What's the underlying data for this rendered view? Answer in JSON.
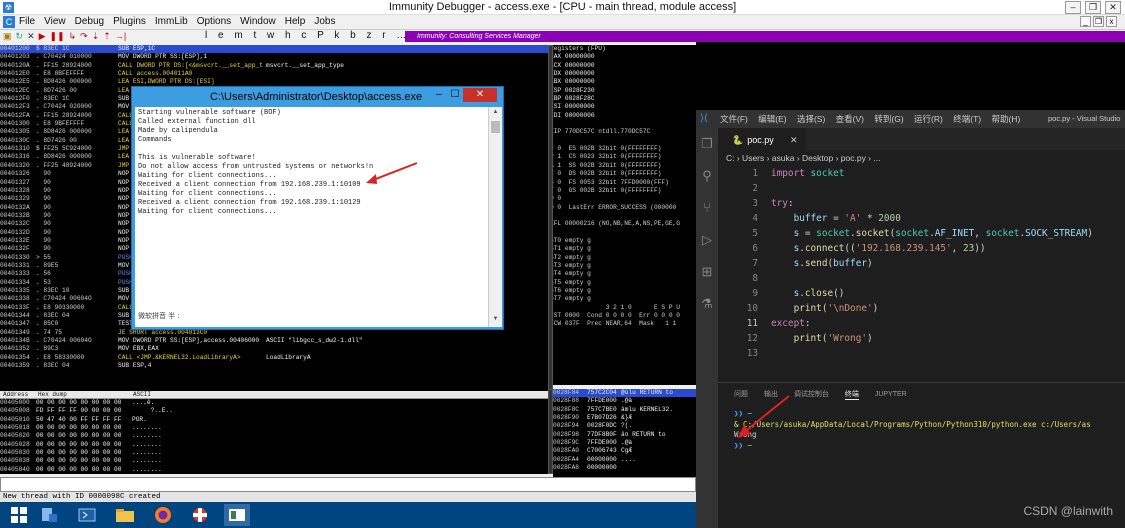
{
  "window": {
    "title": "Immunity Debugger - access.exe - [CPU - main thread, module access]"
  },
  "menu": [
    "File",
    "View",
    "Debug",
    "Plugins",
    "ImmLib",
    "Options",
    "Window",
    "Help",
    "Jobs"
  ],
  "toolbar": {
    "letters": "l e m t w h c P k b z r … s ?",
    "banner": "Immunity: Consulting Services Manager"
  },
  "cpu_rows": [
    {
      "addr": "00401200",
      "hex": "$ 83EC 1C",
      "asm": "SUB ESP,1C",
      "cmt": "",
      "sel": true
    },
    {
      "addr": "00401203",
      "hex": ". C70424 010000",
      "asm": "MOV DWORD PTR SS:[ESP],1",
      "cmt": ""
    },
    {
      "addr": "0040120A",
      "hex": ". FF15 28924000",
      "asm": "CALL DWORD PTR DS:[<&msvcrt.__set_app_t",
      "cmt": "msvcrt.__set_app_type"
    },
    {
      "addr": "004012E0",
      "hex": ". E8 0BFEFFFF",
      "asm": "CALL access.004011A0",
      "cmt": ""
    },
    {
      "addr": "004012E5",
      "hex": ". 8D8426 000000",
      "asm": "LEA ESI,DWORD PTR DS:[ESI]",
      "cmt": ""
    },
    {
      "addr": "004012EC",
      "hex": ". 8D7426 00",
      "asm": "LEA ESI,",
      "cmt": ""
    },
    {
      "addr": "004012F0",
      "hex": ". 83EC 1C",
      "asm": "SUB ESP",
      "cmt": ""
    },
    {
      "addr": "004012F3",
      "hex": ". C70424 020000",
      "asm": "MOV DWO",
      "cmt": ""
    },
    {
      "addr": "004012FA",
      "hex": ". FF15 28924000",
      "asm": "CALL DW",
      "cmt": ""
    },
    {
      "addr": "00401300",
      "hex": ". E8 9BFEFFFF",
      "asm": "CALL ac",
      "cmt": ""
    },
    {
      "addr": "00401305",
      "hex": ". 8D8426 000000",
      "asm": "LEA ESI",
      "cmt": ""
    },
    {
      "addr": "0040130C",
      "hex": ". 8D7426 00",
      "asm": "LEA ESI",
      "cmt": ""
    },
    {
      "addr": "00401310",
      "hex": "$ FF25 5C924000",
      "asm": "JMP DWO",
      "cmt": ""
    },
    {
      "addr": "00401316",
      "hex": ". 8D8426 000000",
      "asm": "LEA ESI",
      "cmt": ""
    },
    {
      "addr": "00401320",
      "hex": ". FF25 48924000",
      "asm": "JMP DWO",
      "cmt": ""
    },
    {
      "addr": "00401326",
      "hex": "  90",
      "asm": "NOP",
      "cmt": ""
    },
    {
      "addr": "00401327",
      "hex": "  90",
      "asm": "NOP",
      "cmt": ""
    },
    {
      "addr": "00401328",
      "hex": "  90",
      "asm": "NOP",
      "cmt": ""
    },
    {
      "addr": "00401329",
      "hex": "  90",
      "asm": "NOP",
      "cmt": ""
    },
    {
      "addr": "0040132A",
      "hex": "  90",
      "asm": "NOP",
      "cmt": ""
    },
    {
      "addr": "0040132B",
      "hex": "  90",
      "asm": "NOP",
      "cmt": ""
    },
    {
      "addr": "0040132C",
      "hex": "  90",
      "asm": "NOP",
      "cmt": ""
    },
    {
      "addr": "0040132D",
      "hex": "  90",
      "asm": "NOP",
      "cmt": ""
    },
    {
      "addr": "0040132E",
      "hex": "  90",
      "asm": "NOP",
      "cmt": ""
    },
    {
      "addr": "0040132F",
      "hex": "  90",
      "asm": "NOP",
      "cmt": ""
    },
    {
      "addr": "00401330",
      "hex": "> 55",
      "asm": "PUSH EB",
      "cmt": ""
    },
    {
      "addr": "00401331",
      "hex": ". 89E5",
      "asm": "MOV EBP",
      "cmt": ""
    },
    {
      "addr": "00401333",
      "hex": ". 56",
      "asm": "PUSH ES",
      "cmt": ""
    },
    {
      "addr": "00401334",
      "hex": ". 53",
      "asm": "PUSH EB",
      "cmt": ""
    },
    {
      "addr": "00401335",
      "hex": ". 83EC 10",
      "asm": "SUB ESP",
      "cmt": ""
    },
    {
      "addr": "00401338",
      "hex": ". C70424 00604O",
      "asm": "MOV DWO",
      "cmt": ""
    },
    {
      "addr": "0040133F",
      "hex": ". E8 90330000",
      "asm": "CALL <J",
      "cmt": ""
    },
    {
      "addr": "00401344",
      "hex": ". 83EC 04",
      "asm": "SUB ESP",
      "cmt": ""
    },
    {
      "addr": "00401347",
      "hex": ". 85C0",
      "asm": "TEST EAX,EAX",
      "cmt": ""
    },
    {
      "addr": "00401349",
      "hex": ". 74 75",
      "asm": "JE SHORT access.004013C0",
      "cmt": ""
    },
    {
      "addr": "0040134B",
      "hex": ". C70424 00604O",
      "asm": "MOV DWORD PTR SS:[ESP],access.00406000",
      "cmt": "ASCII \"libgcc_s_dw2-1.dll\""
    },
    {
      "addr": "00401352",
      "hex": ". 89C3",
      "asm": "MOV EBX,EAX",
      "cmt": ""
    },
    {
      "addr": "00401354",
      "hex": ". E8 58330000",
      "asm": "CALL <JMP.&KERNEL32.LoadLibraryA>",
      "cmt": "LoadLibraryA"
    },
    {
      "addr": "00401359",
      "hex": ". 83EC 04",
      "asm": "SUB ESP,4",
      "cmt": ""
    }
  ],
  "registers": {
    "header": "Registers (FPU)",
    "lines": [
      "EAX 00000000",
      "ECX 00000000",
      "EDX 00000000",
      "EBX 00000000",
      "ESP 0028F230",
      "EBP 0028F28C",
      "ESI 00000000",
      "EDI 00000000",
      "",
      "EIP 770DC57C ntdll.770DC57C",
      "",
      "C 0  ES 002B 32bit 0(FFFFFFFF)",
      "P 1  CS 0023 32bit 0(FFFFFFFF)",
      "A 1  SS 002B 32bit 0(FFFFFFFF)",
      "Z 0  DS 002B 32bit 0(FFFFFFFF)",
      "S 0  FS 0053 32bit 7FFD0000(FFF)",
      "T 0  GS 002B 32bit 0(FFFFFFFF)",
      "D 0",
      "O 0  LastErr ERROR_SUCCESS (000000",
      "",
      "EFL 00000216 (NO,NB,NE,A,NS,PE,GE,G",
      "",
      "ST0 empty g",
      "ST1 empty g",
      "ST2 empty g",
      "ST3 empty g",
      "ST4 empty g",
      "ST5 empty g",
      "ST6 empty g",
      "ST7 empty g",
      "               3 2 1 0      E S P U",
      "FST 0000  Cond 0 0 0 0  Err 0 0 0 0",
      "FCW 037F  Prec NEAR,64  Mask   1 1"
    ]
  },
  "dump": {
    "headers": [
      "Address",
      "Hex dump",
      "ASCII"
    ],
    "rows": [
      {
        "addr": "00405000",
        "hex": "00 00 00 00 00 00 00 00",
        "ascii": "....ê."
      },
      {
        "addr": "00405008",
        "hex": "FD FF FF FF 00 00 00 00",
        "ascii": "     ?..E.."
      },
      {
        "addr": "00405010",
        "hex": "50 47 40 00 FF FF FF FF",
        "ascii": "PGR."
      },
      {
        "addr": "00405018",
        "hex": "00 00 00 00 00 00 00 00",
        "ascii": "........"
      },
      {
        "addr": "00405020",
        "hex": "00 00 00 00 00 00 00 00",
        "ascii": "........"
      },
      {
        "addr": "00405028",
        "hex": "00 00 00 00 00 00 00 00",
        "ascii": "........"
      },
      {
        "addr": "00405030",
        "hex": "00 00 00 00 00 00 00 00",
        "ascii": "........"
      },
      {
        "addr": "00405038",
        "hex": "00 00 00 00 00 00 00 00",
        "ascii": "........"
      },
      {
        "addr": "00405040",
        "hex": "00 00 00 00 00 00 00 00",
        "ascii": "........"
      }
    ]
  },
  "stack": {
    "rows": [
      {
        "addr": "0028F84",
        "val": "757C2C04",
        "cmt": "@ùlu RETURN to"
      },
      {
        "addr": "0028F88",
        "val": "7FFDE000",
        "cmt": ".@à"
      },
      {
        "addr": "0028F8C",
        "val": "757C7BE0",
        "cmt": "àmlu KERNEL32."
      },
      {
        "addr": "0028F90",
        "val": "E7B07D26",
        "cmt": "&}Æ"
      },
      {
        "addr": "0028F94",
        "val": "0028F0DC",
        "cmt": "?(."
      },
      {
        "addr": "0028F98",
        "val": "77DF8B0F",
        "cmt": "ä¤ RETURN to"
      },
      {
        "addr": "0028F9C",
        "val": "7FFDE000",
        "cmt": ".@à"
      },
      {
        "addr": "0028FA0",
        "val": "C7006743",
        "cmt": "CgÆ"
      },
      {
        "addr": "0028FA4",
        "val": "00000000",
        "cmt": "...."
      },
      {
        "addr": "0028FA8",
        "val": "00000000",
        "cmt": ""
      }
    ]
  },
  "status_text": "New thread with ID 0000098C created",
  "console": {
    "title": "C:\\Users\\Administrator\\Desktop\\access.exe",
    "lines": [
      "Starting vulnerable software (BOF)",
      "Called external function dll",
      "Made by calipendula",
      "Commands",
      "",
      "This is vulnerable software!",
      "Do not allow access from untrusted systems or networks!n",
      "Waiting for client connections...",
      "Received a client connection from 192.168.239.1:10109",
      "Waiting for client connections...",
      "Received a client connection from 192.168.239.1:10129",
      "Waiting for client connections..."
    ],
    "ime": "微软拼音 半 :"
  },
  "vscode": {
    "menu": [
      "文件(F)",
      "编辑(E)",
      "选择(S)",
      "查看(V)",
      "转到(G)",
      "运行(R)",
      "终端(T)",
      "帮助(H)"
    ],
    "window_title": "poc.py - Visual Studio",
    "tab": "poc.py",
    "breadcrumb": "C: › Users › asuka › Desktop › poc.py › ...",
    "panel_tabs": [
      "问题",
      "输出",
      "调试控制台",
      "终端",
      "JUPYTER"
    ],
    "terminal": {
      "prompt1": "~",
      "cmd": "& C:/Users/asuka/AppData/Local/Programs/Python/Python310/python.exe c:/Users/as",
      "out": "Wrong",
      "prompt2": "~"
    },
    "code_lines": [
      "1",
      "2",
      "3",
      "4",
      "5",
      "6",
      "7",
      "8",
      "9",
      "10",
      "11",
      "12",
      "13"
    ]
  },
  "watermark": "CSDN @lainwith"
}
